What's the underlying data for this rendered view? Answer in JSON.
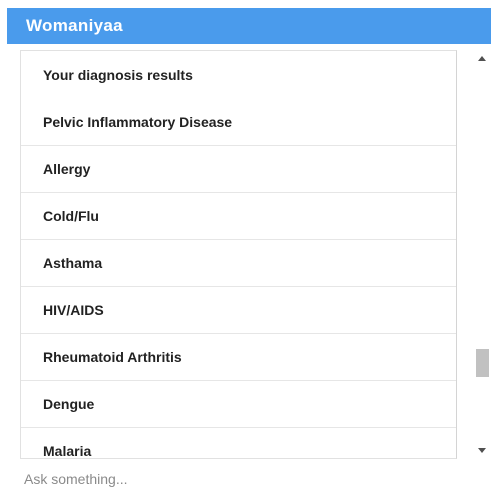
{
  "app": {
    "title": "Womaniyaa",
    "header_color": "#4a9bec"
  },
  "results": {
    "heading": "Your diagnosis results",
    "items": [
      "Pelvic Inflammatory Disease",
      "Allergy",
      "Cold/Flu",
      "Asthama",
      "HIV/AIDS",
      "Rheumatoid Arthritis",
      "Dengue",
      "Malaria"
    ]
  },
  "scrollbar": {
    "up_icon": "chevron-up-icon",
    "down_icon": "chevron-down-icon"
  },
  "chat": {
    "placeholder": "Ask something...",
    "value": ""
  }
}
